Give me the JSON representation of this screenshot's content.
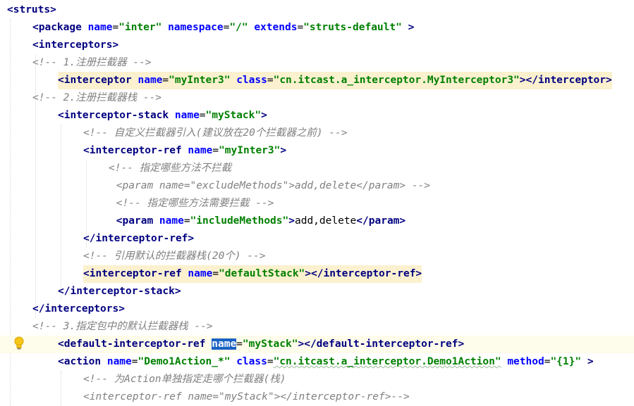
{
  "lines": [
    {
      "indent": 0,
      "tokens": [
        [
          "tag",
          "<struts"
        ],
        [
          "tag",
          ">"
        ]
      ]
    },
    {
      "indent": 1,
      "tokens": [
        [
          "tag",
          "<package "
        ],
        [
          "attr",
          "name"
        ],
        [
          "punct",
          "="
        ],
        [
          "val",
          "\"inter\""
        ],
        [
          "punct",
          " "
        ],
        [
          "attr",
          "namespace"
        ],
        [
          "punct",
          "="
        ],
        [
          "val",
          "\"/\""
        ],
        [
          "punct",
          " "
        ],
        [
          "attr",
          "extends"
        ],
        [
          "punct",
          "="
        ],
        [
          "val",
          "\"struts-default\""
        ],
        [
          "punct",
          " "
        ],
        [
          "tag",
          ">"
        ]
      ]
    },
    {
      "indent": 1,
      "tokens": [
        [
          "tag",
          "<interceptors"
        ],
        [
          "tag",
          ">"
        ]
      ]
    },
    {
      "indent": 1,
      "tokens": [
        [
          "comment",
          "<!-- 1.注册拦截器 -->"
        ]
      ]
    },
    {
      "indent": 2,
      "hl": true,
      "tokens": [
        [
          "tag",
          "<interceptor "
        ],
        [
          "attr",
          "name"
        ],
        [
          "punct",
          "="
        ],
        [
          "val",
          "\"myInter3\""
        ],
        [
          "punct",
          " "
        ],
        [
          "attr",
          "class"
        ],
        [
          "punct",
          "="
        ],
        [
          "val",
          "\"cn.itcast.a_interceptor.MyInterceptor3\""
        ],
        [
          "tag",
          ">"
        ],
        [
          "tag",
          "</interceptor>"
        ]
      ]
    },
    {
      "indent": 1,
      "tokens": [
        [
          "comment",
          "<!-- 2.注册拦截器栈 -->"
        ]
      ]
    },
    {
      "indent": 2,
      "tokens": [
        [
          "tag",
          "<interceptor-stack "
        ],
        [
          "attr",
          "name"
        ],
        [
          "punct",
          "="
        ],
        [
          "val",
          "\"myStack\""
        ],
        [
          "tag",
          ">"
        ]
      ]
    },
    {
      "indent": 3,
      "tokens": [
        [
          "comment",
          "<!-- 自定义拦截器引入(建议放在20个拦截器之前) -->"
        ]
      ]
    },
    {
      "indent": 3,
      "tokens": [
        [
          "tag",
          "<interceptor-ref "
        ],
        [
          "attr",
          "name"
        ],
        [
          "punct",
          "="
        ],
        [
          "val",
          "\"myInter3\""
        ],
        [
          "tag",
          ">"
        ]
      ]
    },
    {
      "indent": 4,
      "tokens": [
        [
          "comment",
          "<!-- 指定哪些方法不拦截"
        ]
      ]
    },
    {
      "indent": 4.3,
      "tokens": [
        [
          "comment",
          "<param name=\"excludeMethods\">add,delete</param> -->"
        ]
      ]
    },
    {
      "indent": 4.3,
      "tokens": [
        [
          "comment",
          "<!-- 指定哪些方法需要拦截 -->"
        ]
      ]
    },
    {
      "indent": 4.3,
      "tokens": [
        [
          "tag",
          "<param "
        ],
        [
          "attr",
          "name"
        ],
        [
          "punct",
          "="
        ],
        [
          "val",
          "\"includeMethods\""
        ],
        [
          "tag",
          ">"
        ],
        [
          "text",
          "add,delete"
        ],
        [
          "tag",
          "</param>"
        ]
      ]
    },
    {
      "indent": 3,
      "tokens": [
        [
          "tag",
          "</interceptor-ref>"
        ]
      ]
    },
    {
      "indent": 3,
      "tokens": [
        [
          "comment",
          "<!-- 引用默认的拦截器栈(20个) -->"
        ]
      ]
    },
    {
      "indent": 3,
      "hl": true,
      "tokens": [
        [
          "tag",
          "<interceptor-ref "
        ],
        [
          "attr",
          "name"
        ],
        [
          "punct",
          "="
        ],
        [
          "val",
          "\"defaultStack\""
        ],
        [
          "tag",
          ">"
        ],
        [
          "tag",
          "</interceptor-ref>"
        ]
      ]
    },
    {
      "indent": 2,
      "tokens": [
        [
          "tag",
          "</interceptor-stack>"
        ]
      ]
    },
    {
      "indent": 1,
      "tokens": [
        [
          "tag",
          "</interceptors>"
        ]
      ]
    },
    {
      "indent": 1,
      "tokens": [
        [
          "comment",
          "<!-- 3.指定包中的默认拦截器栈 -->"
        ]
      ]
    },
    {
      "indent": 2,
      "current": true,
      "tokens": [
        [
          "tag",
          "<default-interceptor-ref "
        ],
        [
          "attr-sel",
          "name"
        ],
        [
          "punct",
          "="
        ],
        [
          "val",
          "\"myStack\""
        ],
        [
          "tag",
          ">"
        ],
        [
          "tag",
          "</default-interceptor-ref>"
        ]
      ]
    },
    {
      "indent": 2,
      "tokens": [
        [
          "tag",
          "<action "
        ],
        [
          "attr",
          "name"
        ],
        [
          "punct",
          "="
        ],
        [
          "val",
          "\"Demo1Action_*\""
        ],
        [
          "punct",
          " "
        ],
        [
          "attr",
          "class"
        ],
        [
          "punct",
          "="
        ],
        [
          "val-u",
          "\"cn.itcast.a_interceptor.Demo1Action\""
        ],
        [
          "punct",
          " "
        ],
        [
          "attr",
          "method"
        ],
        [
          "punct",
          "="
        ],
        [
          "val",
          "\"{1}\""
        ],
        [
          "punct",
          " "
        ],
        [
          "tag",
          ">"
        ]
      ]
    },
    {
      "indent": 3,
      "tokens": [
        [
          "comment",
          "<!-- 为Action单独指定走哪个拦截器(栈)"
        ]
      ]
    },
    {
      "indent": 3,
      "tokens": [
        [
          "comment",
          "<interceptor-ref name=\"myStack\"></interceptor-ref>-->"
        ]
      ]
    }
  ],
  "icons": {
    "intention": "lightbulb-icon",
    "fold": "fold-marker-icon"
  },
  "colors": {
    "tag": "#000080",
    "attr": "#0000ff",
    "value": "#008000",
    "comment": "#808080",
    "highlight": "#fbf1cf",
    "selection": "#1a62c4",
    "current_line": "#fefcea"
  }
}
